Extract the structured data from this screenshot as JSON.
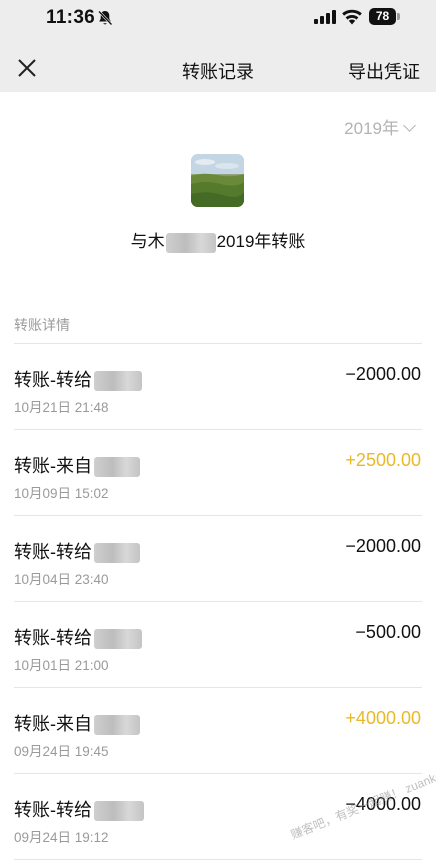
{
  "status_bar": {
    "time": "11:36",
    "battery": "78"
  },
  "navbar": {
    "title": "转账记录",
    "export_label": "导出凭证"
  },
  "year_filter": "2019年",
  "header": {
    "prefix": "与",
    "name_visible_start": "木",
    "suffix": "2019年转账"
  },
  "section_label": "转账详情",
  "records": [
    {
      "title": "转账-转给",
      "date": "10月21日 21:48",
      "amount": "−2000.00",
      "direction": "out"
    },
    {
      "title": "转账-来自",
      "date": "10月09日 15:02",
      "amount": "+2500.00",
      "direction": "in"
    },
    {
      "title": "转账-转给",
      "date": "10月04日 23:40",
      "amount": "−2000.00",
      "direction": "out"
    },
    {
      "title": "转账-转给",
      "date": "10月01日 21:00",
      "amount": "−500.00",
      "direction": "out"
    },
    {
      "title": "转账-来自",
      "date": "09月24日 19:45",
      "amount": "+4000.00",
      "direction": "in"
    },
    {
      "title": "转账-转给",
      "date": "09月24日 19:12",
      "amount": "−4000.00",
      "direction": "out"
    }
  ],
  "colors": {
    "income": "#e9b928",
    "expense": "#111111",
    "muted": "#9a9a9a"
  }
}
